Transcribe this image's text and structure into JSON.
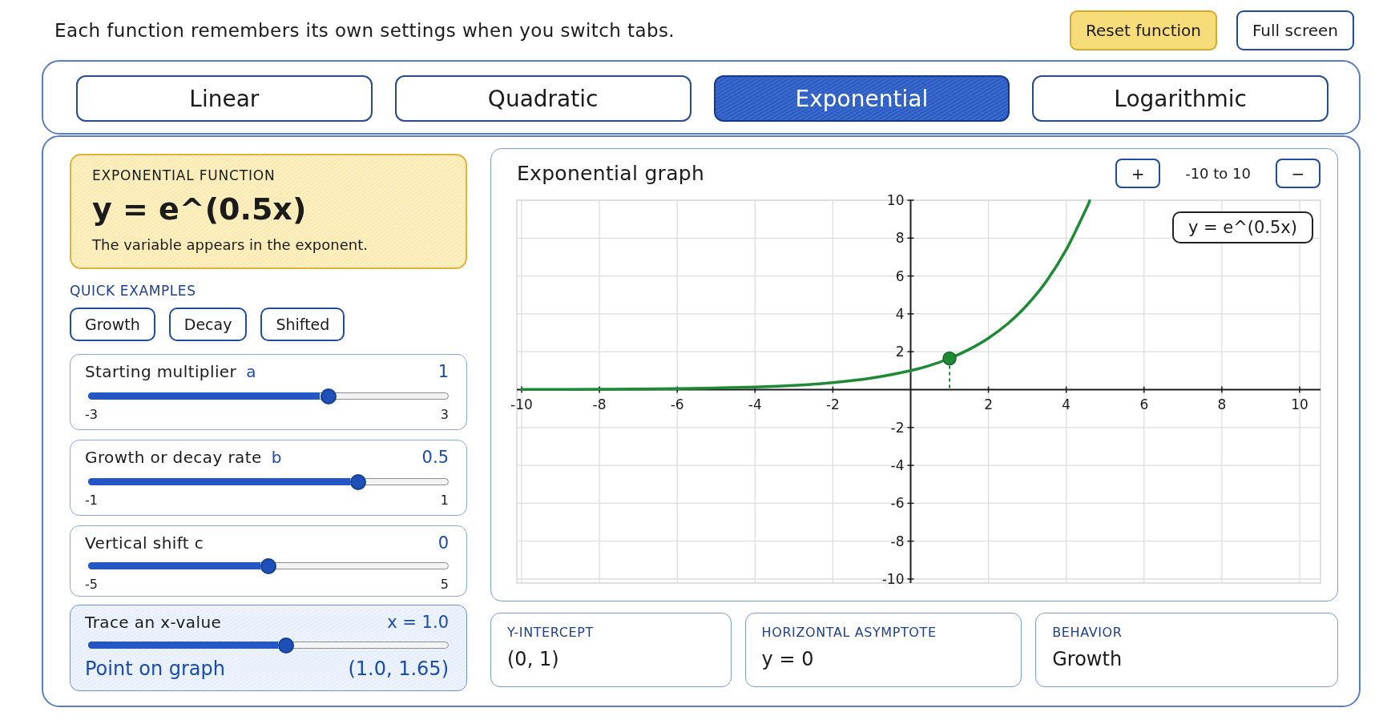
{
  "header": {
    "note": "Each function remembers its own settings when you switch tabs.",
    "buttons": [
      {
        "label": "Reset function",
        "kind": "primary"
      },
      {
        "label": "Full screen",
        "kind": "secondary"
      }
    ]
  },
  "tabs": [
    {
      "label": "Linear",
      "selected": false
    },
    {
      "label": "Quadratic",
      "selected": false
    },
    {
      "label": "Exponential",
      "selected": true
    },
    {
      "label": "Logarithmic",
      "selected": false
    }
  ],
  "function_card": {
    "heading": "EXPONENTIAL FUNCTION",
    "formula": "y = e^(0.5x)",
    "description": "The variable appears in the exponent."
  },
  "quick_examples": {
    "heading": "QUICK EXAMPLES",
    "buttons": [
      "Growth",
      "Decay",
      "Shifted"
    ]
  },
  "parameters": [
    {
      "label": "Starting multiplier",
      "variable": "a",
      "value": "1",
      "min": "-3",
      "max": "3",
      "level": 0.667
    },
    {
      "label": "Growth or decay rate",
      "variable": "b",
      "value": "0.5",
      "min": "-1",
      "max": "1",
      "level": 0.75
    },
    {
      "label": "Vertical shift c",
      "value": "0",
      "min": "-5",
      "max": "5",
      "level": 0.5
    }
  ],
  "trace": {
    "label": "Trace an x-value",
    "value": "x = 1.0",
    "level": 0.55,
    "point_label": "Point on graph",
    "point_value": "(1.0, 1.65)"
  },
  "graph": {
    "title": "Exponential graph",
    "zoom_in": "+",
    "range": "-10 to 10",
    "zoom_out": "−",
    "chart_data": {
      "type": "line",
      "x": [
        -10,
        -8,
        -6,
        -4,
        -3,
        -2,
        -1,
        0,
        0.5,
        1,
        1.5,
        2,
        2.5,
        3,
        3.5,
        4,
        4.5,
        4.6
      ],
      "series": [
        {
          "name": "y = e^(0.5x)",
          "color": "#1f8a36",
          "values": [
            0.01,
            0.02,
            0.05,
            0.14,
            0.22,
            0.37,
            0.61,
            1,
            1.28,
            1.65,
            2.12,
            2.72,
            3.49,
            4.48,
            5.75,
            7.39,
            9.49,
            9.97
          ]
        }
      ],
      "xlim": [
        -10,
        10
      ],
      "ylim": [
        -10,
        10
      ],
      "xticks": [
        -10,
        -8,
        -6,
        -4,
        -2,
        2,
        4,
        6,
        8,
        10
      ],
      "yticks": [
        -10,
        -8,
        -6,
        -4,
        -2,
        2,
        4,
        6,
        8,
        10
      ],
      "grid": true
    }
  },
  "stats": [
    {
      "label": "Y-INTERCEPT",
      "value": "(0, 1)"
    },
    {
      "label": "HORIZONTAL ASYMPTOTE",
      "value": "y = 0"
    },
    {
      "label": "BEHAVIOR",
      "value": "Growth"
    }
  ]
}
